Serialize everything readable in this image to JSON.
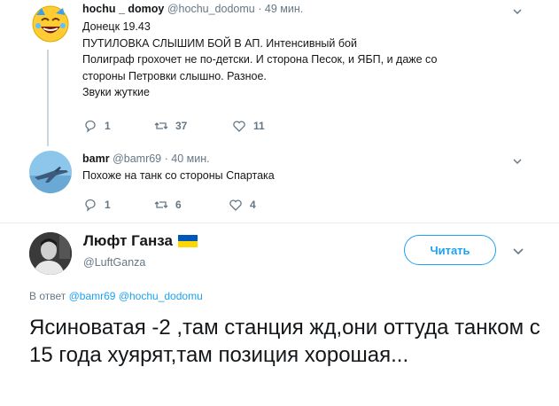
{
  "tweet1": {
    "avatar_icon": "laughing-emoji-avatar",
    "name": "hochu _ domoy",
    "handle": "@hochu_dodomu",
    "dot": "·",
    "time": "49 мин.",
    "lines": [
      "Донецк 19.43",
      "ПУТИЛОВКА СЛЫШИМ БОЙ В АП. Интенсивный бой",
      "Полиграф грохочет не по-детски. И сторона Песок, и ЯБП, и даже со",
      "стороны Петровки слышно. Разное.",
      "Звуки жуткие"
    ],
    "replies": "1",
    "retweets": "37",
    "likes": "11"
  },
  "tweet2": {
    "avatar_icon": "fighter-jet-avatar",
    "name": "bamr",
    "handle": "@bamr69",
    "dot": "·",
    "time": "40 мин.",
    "text": "Похоже на танк со стороны Спартака",
    "replies": "1",
    "retweets": "6",
    "likes": "4"
  },
  "main": {
    "avatar_icon": "person-photo-avatar",
    "name": "Люфт Ганза",
    "flag_icon": "ukraine-flag-icon",
    "handle": "@LuftGanza",
    "follow_label": "Читать",
    "reply_prefix": "В ответ",
    "reply_user1": "@bamr69",
    "reply_user2": "@hochu_dodomu",
    "text": "Ясиноватая -2 ,там станция жд,они оттуда танком с 15 года хуярят,там позиция хорошая..."
  },
  "colors": {
    "accent": "#1da1f2",
    "muted": "#657786",
    "text": "#14171a",
    "flag_blue": "#0057b7",
    "flag_yellow": "#ffd700"
  }
}
